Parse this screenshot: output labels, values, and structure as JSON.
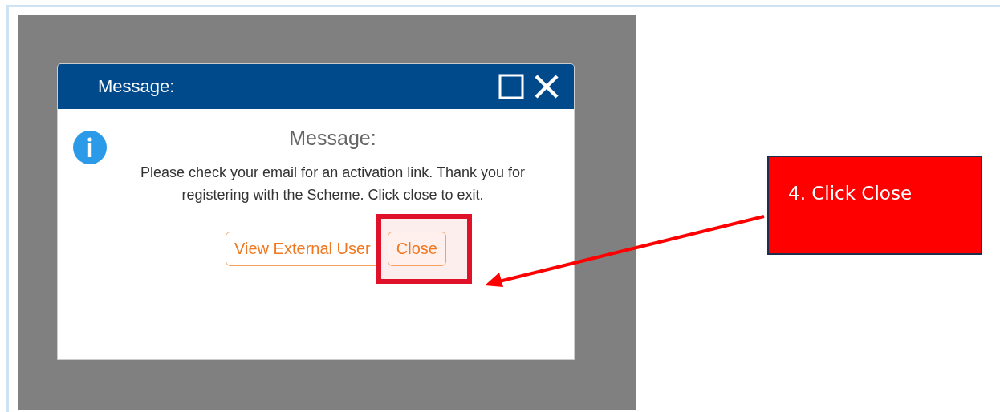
{
  "dialog": {
    "title": "Message:",
    "heading": "Message:",
    "message": "Please check your email for an activation link. Thank you for registering with the Scheme. Click close to exit.",
    "buttons": [
      {
        "label": "View External User",
        "highlighted": false
      },
      {
        "label": "Close",
        "highlighted": true
      }
    ]
  },
  "callout": {
    "text": "4. Click Close"
  }
}
